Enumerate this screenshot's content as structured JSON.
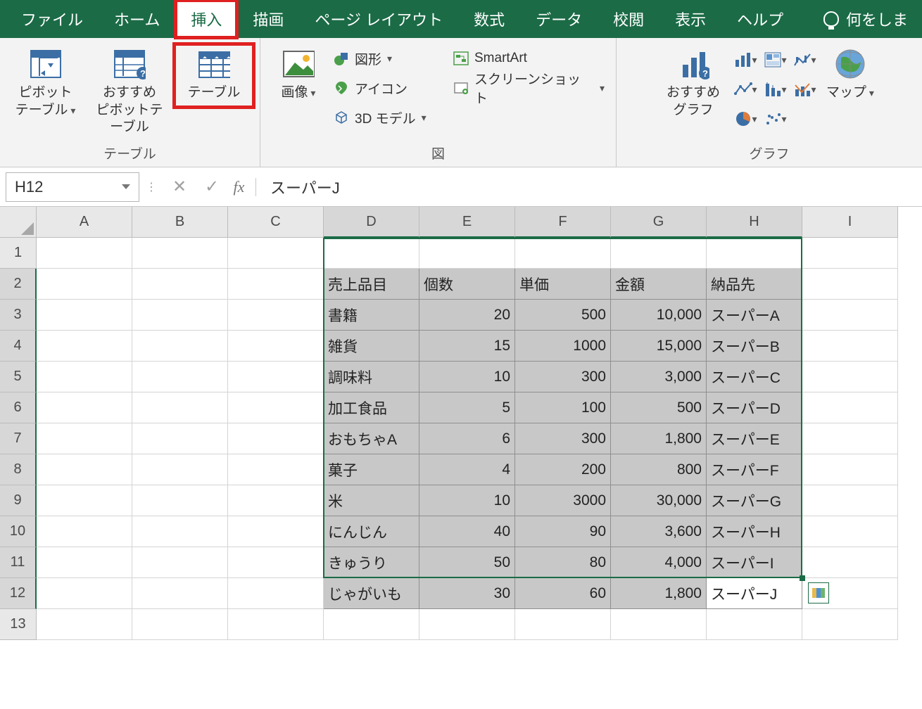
{
  "tabs": {
    "file": "ファイル",
    "home": "ホーム",
    "insert": "挿入",
    "draw": "描画",
    "pagelayout": "ページ レイアウト",
    "formulas": "数式",
    "data": "データ",
    "review": "校閲",
    "view": "表示",
    "help": "ヘルプ",
    "tellme": "何をしま"
  },
  "ribbon": {
    "group_tables": "テーブル",
    "group_illustrations": "図",
    "group_charts": "グラフ",
    "pivot": "ピボットテーブル",
    "recommended_pivot": "おすすめピボットテーブル",
    "recommended_pivot_line1": "おすすめ",
    "recommended_pivot_line2": "ピボットテーブル",
    "table": "テーブル",
    "pictures": "画像",
    "shapes": "図形",
    "icons": "アイコン",
    "models3d": "3D モデル",
    "smartart": "SmartArt",
    "screenshot": "スクリーンショット",
    "recommended_charts_line1": "おすすめ",
    "recommended_charts_line2": "グラフ",
    "maps": "マップ"
  },
  "formula_bar": {
    "name_box": "H12",
    "value": "スーパーJ"
  },
  "columns": [
    "A",
    "B",
    "C",
    "D",
    "E",
    "F",
    "G",
    "H",
    "I"
  ],
  "rows": [
    "1",
    "2",
    "3",
    "4",
    "5",
    "6",
    "7",
    "8",
    "9",
    "10",
    "11",
    "12",
    "13"
  ],
  "table": {
    "headers": [
      "売上品目",
      "個数",
      "単価",
      "金額",
      "納品先"
    ],
    "data": [
      [
        "書籍",
        "20",
        "500",
        "10,000",
        "スーパーA"
      ],
      [
        "雑貨",
        "15",
        "1000",
        "15,000",
        "スーパーB"
      ],
      [
        "調味料",
        "10",
        "300",
        "3,000",
        "スーパーC"
      ],
      [
        "加工食品",
        "5",
        "100",
        "500",
        "スーパーD"
      ],
      [
        "おもちゃA",
        "6",
        "300",
        "1,800",
        "スーパーE"
      ],
      [
        "菓子",
        "4",
        "200",
        "800",
        "スーパーF"
      ],
      [
        "米",
        "10",
        "3000",
        "30,000",
        "スーパーG"
      ],
      [
        "にんじん",
        "40",
        "90",
        "3,600",
        "スーパーH"
      ],
      [
        "きゅうり",
        "50",
        "80",
        "4,000",
        "スーパーI"
      ],
      [
        "じゃがいも",
        "30",
        "60",
        "1,800",
        "スーパーJ"
      ]
    ]
  }
}
